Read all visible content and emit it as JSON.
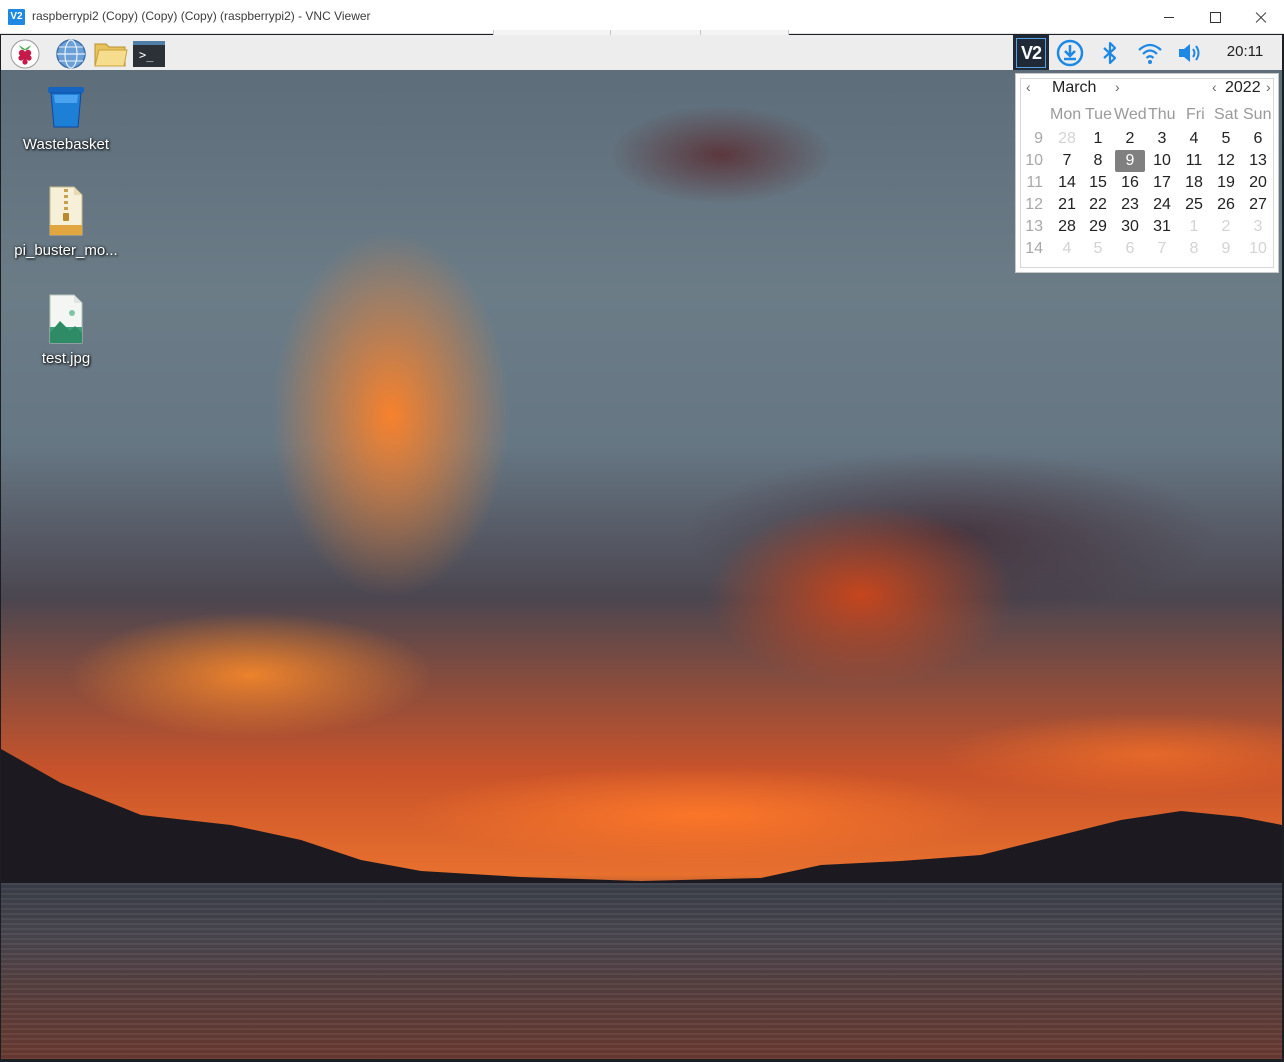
{
  "window": {
    "title": "raspberrypi2 (Copy) (Copy) (Copy) (raspberrypi2) - VNC Viewer",
    "app_icon_text": "V2"
  },
  "panel": {
    "launchers": [
      "raspberry-pi-menu-icon",
      "web-browser-icon",
      "file-manager-icon",
      "terminal-icon"
    ],
    "terminal_glyph": ">_",
    "tray_vnc_text": "V2",
    "clock": "20:11"
  },
  "desktop_icons": [
    {
      "label": "Wastebasket",
      "icon": "wastebasket-icon"
    },
    {
      "label": "pi_buster_mo...",
      "icon": "zip-archive-icon"
    },
    {
      "label": "test.jpg",
      "icon": "image-file-icon"
    }
  ],
  "calendar": {
    "month": "March",
    "year": "2022",
    "prev_arrow": "‹",
    "next_arrow": "›",
    "weekday_headers": [
      "Mon",
      "Tue",
      "Wed",
      "Thu",
      "Fri",
      "Sat",
      "Sun"
    ],
    "selected_day": "9",
    "weeks": [
      {
        "week": "9",
        "days": [
          "28",
          "1",
          "2",
          "3",
          "4",
          "5",
          "6"
        ]
      },
      {
        "week": "10",
        "days": [
          "7",
          "8",
          "9",
          "10",
          "11",
          "12",
          "13"
        ]
      },
      {
        "week": "11",
        "days": [
          "14",
          "15",
          "16",
          "17",
          "18",
          "19",
          "20"
        ]
      },
      {
        "week": "12",
        "days": [
          "21",
          "22",
          "23",
          "24",
          "25",
          "26",
          "27"
        ]
      },
      {
        "week": "13",
        "days": [
          "28",
          "29",
          "30",
          "31",
          "1",
          "2",
          "3"
        ]
      },
      {
        "week": "14",
        "days": [
          "4",
          "5",
          "6",
          "7",
          "8",
          "9",
          "10"
        ]
      }
    ]
  },
  "colors": {
    "accent_blue": "#1e88e5",
    "panel_bg": "#ededed",
    "selected_day_bg": "#808080"
  }
}
